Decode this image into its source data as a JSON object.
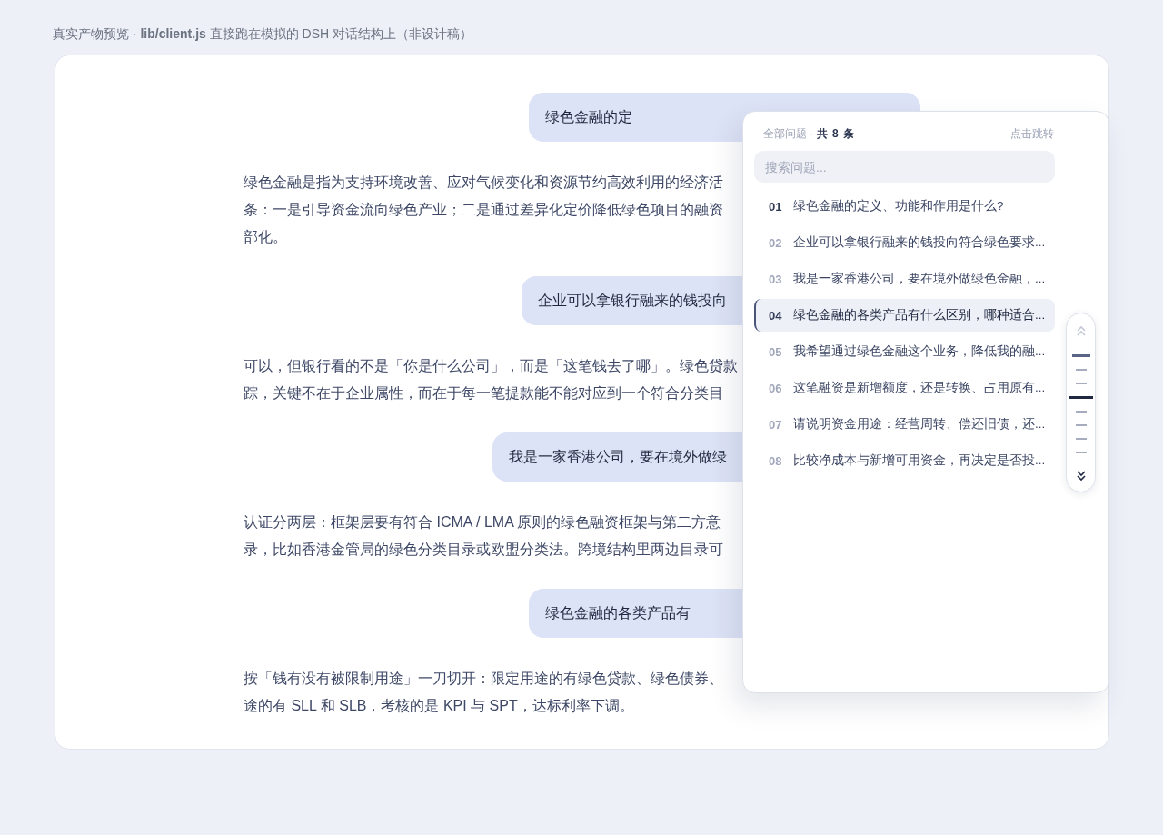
{
  "caption": "真实产物预览 · **lib/client.js** 直接跑在模拟的 DSH 对话结构上（非设计稿）",
  "messages": [
    {
      "kind": "user",
      "text": "绿色金融的定"
    },
    {
      "kind": "answer",
      "lines": [
        "绿色金融是指为支持环境改善、应对气候变化和资源节约高效利用的经济活",
        "条：一是引导资金流向绿色产业；二是通过差异化定价降低绿色项目的融资",
        "部化。"
      ]
    },
    {
      "kind": "user",
      "text": "企业可以拿银行融来的钱投向"
    },
    {
      "kind": "answer",
      "lines": [
        "可以，但银行看的不是「你是什么公司」，而是「这笔钱去了哪」。绿色贷款",
        "踪，关键不在于企业属性，而在于每一笔提款能不能对应到一个符合分类目"
      ]
    },
    {
      "kind": "user",
      "text": "我是一家香港公司，要在境外做绿"
    },
    {
      "kind": "answer",
      "lines": [
        "认证分两层：框架层要有符合 ICMA / LMA 原则的绿色融资框架与第二方意",
        "录，比如香港金管局的绿色分类目录或欧盟分类法。跨境结构里两边目录可"
      ]
    },
    {
      "kind": "user",
      "text": "绿色金融的各类产品有"
    },
    {
      "kind": "answer",
      "lines": [
        "按「钱有没有被限制用途」一刀切开：限定用途的有绿色贷款、绿色债券、",
        "途的有 SLL 和 SLB，考核的是 KPI 与 SPT，达标利率下调。"
      ]
    }
  ],
  "panel": {
    "title": "全部问题 · ",
    "count": "共 8 条",
    "hint": "点击跳转",
    "search": {
      "placeholder": "搜索问题..."
    },
    "items": [
      {
        "number": "01",
        "text": "绿色金融的定义、功能和作用是什么?",
        "current": true,
        "selected": false
      },
      {
        "number": "02",
        "text": "企业可以拿银行融来的钱投向符合绿色要求...",
        "current": false,
        "selected": false
      },
      {
        "number": "03",
        "text": "我是一家香港公司，要在境外做绿色金融，...",
        "current": false,
        "selected": false
      },
      {
        "number": "04",
        "text": "绿色金融的各类产品有什么区别，哪种适合...",
        "current": false,
        "selected": true
      },
      {
        "number": "05",
        "text": "我希望通过绿色金融这个业务，降低我的融...",
        "current": false,
        "selected": false
      },
      {
        "number": "06",
        "text": "这笔融资是新增额度，还是转换、占用原有...",
        "current": false,
        "selected": false
      },
      {
        "number": "07",
        "text": "请说明资金用途：经营周转、偿还旧债，还...",
        "current": false,
        "selected": false
      },
      {
        "number": "08",
        "text": "比较净成本与新增可用资金，再决定是否投...",
        "current": false,
        "selected": false
      }
    ],
    "scroller": {
      "up_disabled": true,
      "down_disabled": false
    }
  }
}
